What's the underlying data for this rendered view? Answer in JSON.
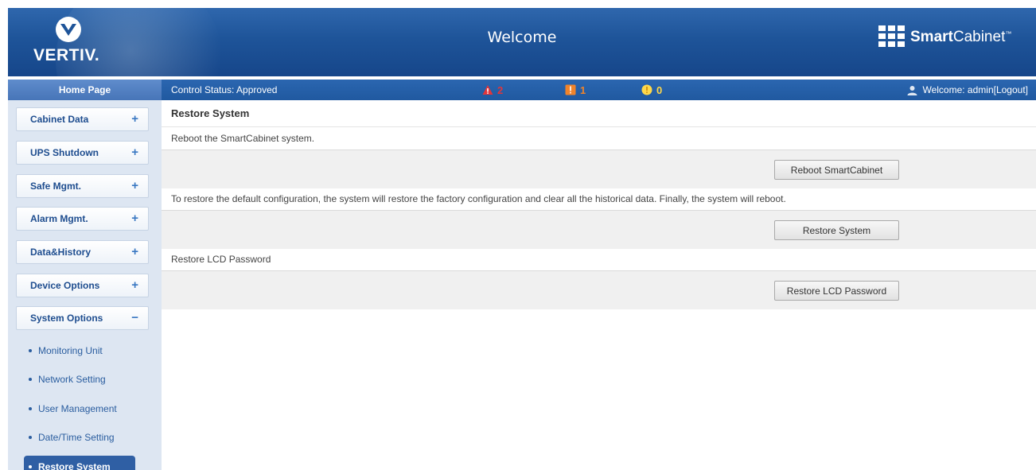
{
  "header": {
    "logo_text": "VERTIV.",
    "title": "Welcome",
    "product_name_bold": "Smart",
    "product_name_rest": "Cabinet",
    "product_tm": "™"
  },
  "statusbar": {
    "home_label": "Home Page",
    "control_status": "Control Status:  Approved",
    "alarms": {
      "critical": "2",
      "major": "1",
      "minor": "0"
    },
    "welcome_prefix": "Welcome: admin",
    "logout_label": "[Logout]"
  },
  "sidebar": {
    "menu": [
      {
        "label": "Cabinet Data",
        "toggle": "+"
      },
      {
        "label": "UPS Shutdown",
        "toggle": "+"
      },
      {
        "label": "Safe Mgmt.",
        "toggle": "+"
      },
      {
        "label": "Alarm Mgmt.",
        "toggle": "+"
      },
      {
        "label": "Data&History",
        "toggle": "+"
      },
      {
        "label": "Device Options",
        "toggle": "+"
      },
      {
        "label": "System Options",
        "toggle": "−"
      }
    ],
    "sub_items": [
      {
        "label": "Monitoring Unit"
      },
      {
        "label": "Network Setting"
      },
      {
        "label": "User Management"
      },
      {
        "label": "Date/Time Setting"
      },
      {
        "label": "Restore System"
      }
    ]
  },
  "content": {
    "title": "Restore System",
    "sections": [
      {
        "description": "Reboot the SmartCabinet system.",
        "button": "Reboot SmartCabinet"
      },
      {
        "description": "To restore the default configuration, the system will restore the factory configuration and clear all the historical data. Finally, the system will reboot.",
        "button": "Restore System"
      },
      {
        "description": "Restore LCD Password",
        "button": "Restore LCD Password"
      }
    ]
  },
  "colors": {
    "header_blue": "#1e5499",
    "critical": "#e2353a",
    "major": "#f0832a",
    "minor": "#ffd84a",
    "active_nav": "#2f5fa4"
  }
}
